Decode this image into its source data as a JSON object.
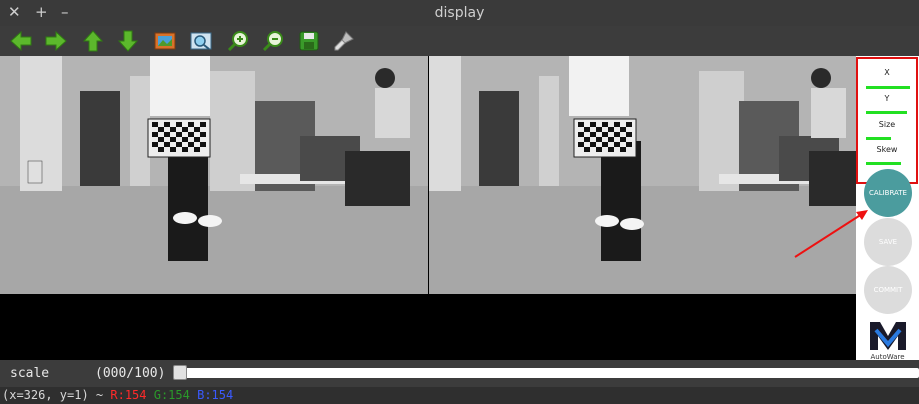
{
  "window": {
    "title": "display",
    "controls": {
      "close": "✕",
      "maximize": "+",
      "minimize": "–"
    }
  },
  "toolbar": {
    "buttons": [
      {
        "name": "back",
        "icon": "arrow-left-icon"
      },
      {
        "name": "forward",
        "icon": "arrow-right-icon"
      },
      {
        "name": "up",
        "icon": "arrow-up-icon"
      },
      {
        "name": "down",
        "icon": "arrow-down-icon"
      },
      {
        "name": "image",
        "icon": "image-icon"
      },
      {
        "name": "fit",
        "icon": "zoom-fit-icon"
      },
      {
        "name": "zoom-in",
        "icon": "zoom-in-icon"
      },
      {
        "name": "zoom-out",
        "icon": "zoom-out-icon"
      },
      {
        "name": "save",
        "icon": "save-icon"
      },
      {
        "name": "properties",
        "icon": "brush-icon"
      }
    ]
  },
  "panel": {
    "metrics": [
      {
        "label": "X",
        "progress": 0.95
      },
      {
        "label": "Y",
        "progress": 0.9
      },
      {
        "label": "Size",
        "progress": 0.55
      },
      {
        "label": "Skew",
        "progress": 0.75
      }
    ],
    "buttons": {
      "calibrate": "CALIBRATE",
      "save": "SAVE",
      "commit": "COMMIT"
    },
    "logo_text": "AutoWare"
  },
  "scale": {
    "label": "scale",
    "value_text": "(000/100)",
    "value": 0
  },
  "status": {
    "coords": "(x=326, y=1) ~ ",
    "r": "R:154",
    "g": "G:154",
    "b": "B:154"
  },
  "colors": {
    "metric_bar": "#22e022",
    "calibrate_bg": "#4b9c9e",
    "highlight_border": "#e01010"
  }
}
